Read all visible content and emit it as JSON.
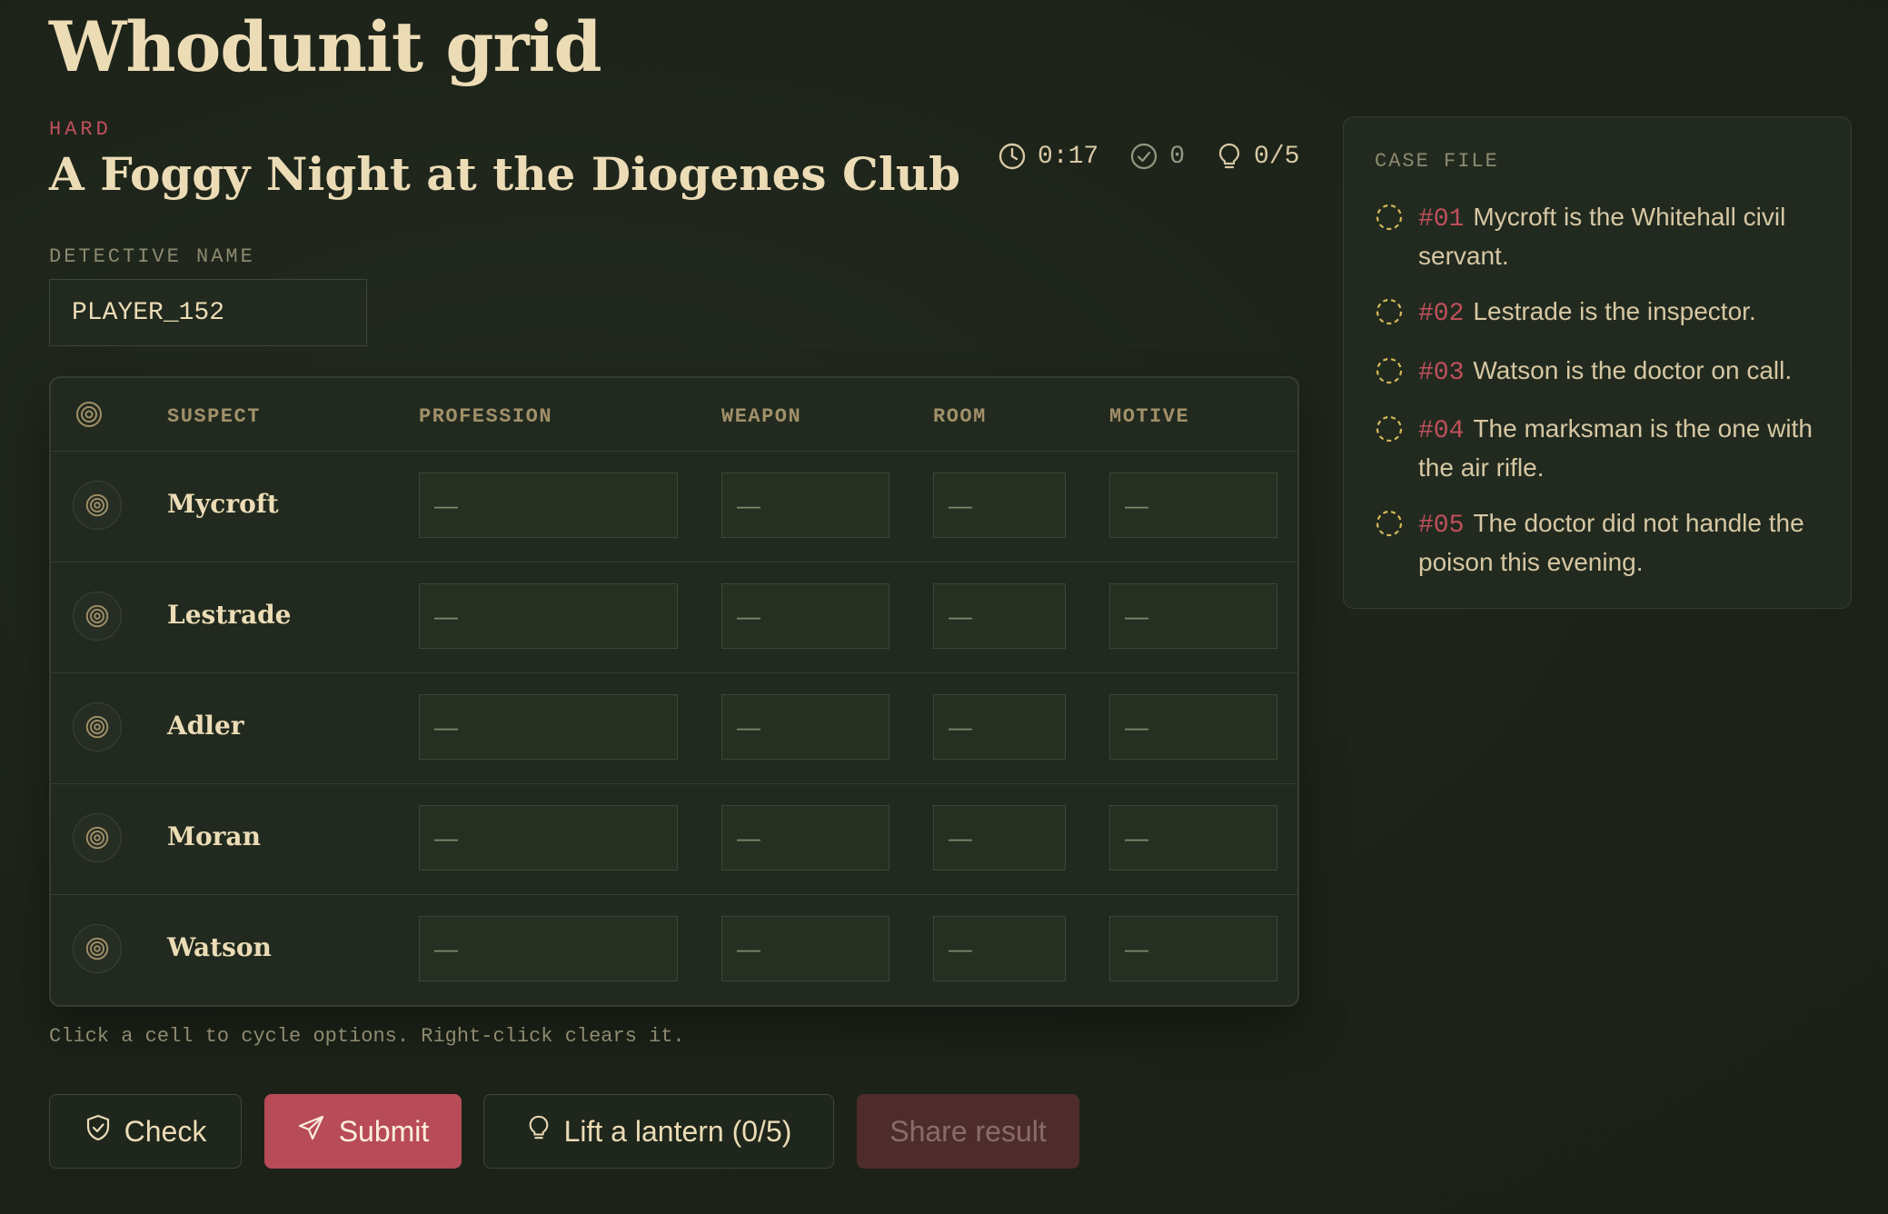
{
  "app": {
    "title": "Whodunit grid"
  },
  "puzzle": {
    "difficulty": "HARD",
    "title": "A Foggy Night at the Diogenes Club"
  },
  "stats": {
    "timer": "0:17",
    "checks": "0",
    "hints": "0/5"
  },
  "detective": {
    "label": "DETECTIVE NAME",
    "value": "PLAYER_152"
  },
  "grid": {
    "columns": [
      "SUSPECT",
      "PROFESSION",
      "WEAPON",
      "ROOM",
      "MOTIVE"
    ],
    "rows": [
      {
        "suspect": "Mycroft",
        "profession": "—",
        "weapon": "—",
        "room": "—",
        "motive": "—"
      },
      {
        "suspect": "Lestrade",
        "profession": "—",
        "weapon": "—",
        "room": "—",
        "motive": "—"
      },
      {
        "suspect": "Adler",
        "profession": "—",
        "weapon": "—",
        "room": "—",
        "motive": "—"
      },
      {
        "suspect": "Moran",
        "profession": "—",
        "weapon": "—",
        "room": "—",
        "motive": "—"
      },
      {
        "suspect": "Watson",
        "profession": "—",
        "weapon": "—",
        "room": "—",
        "motive": "—"
      }
    ],
    "hint": "Click a cell to cycle options. Right-click clears it."
  },
  "buttons": {
    "check": "Check",
    "submit": "Submit",
    "lantern": "Lift a lantern (0/5)",
    "share": "Share result"
  },
  "case_file": {
    "label": "CASE FILE",
    "clues": [
      {
        "num": "#01",
        "text": "Mycroft is the Whitehall civil servant."
      },
      {
        "num": "#02",
        "text": "Lestrade is the inspector."
      },
      {
        "num": "#03",
        "text": "Watson is the doctor on call."
      },
      {
        "num": "#04",
        "text": "The marksman is the one with the air rifle."
      },
      {
        "num": "#05",
        "text": "The doctor did not handle the poison this evening."
      }
    ]
  },
  "colors": {
    "background": "#1e2419",
    "accent": "#b84b58",
    "title": "#ecdcb6",
    "muted": "#8d8a70",
    "clue_icon": "#d6b85a"
  },
  "icons": {
    "timer": "clock-icon",
    "checks": "check-circle-icon",
    "hints": "lightbulb-icon",
    "suspect": "target-icon",
    "clue": "dashed-circle-icon"
  }
}
